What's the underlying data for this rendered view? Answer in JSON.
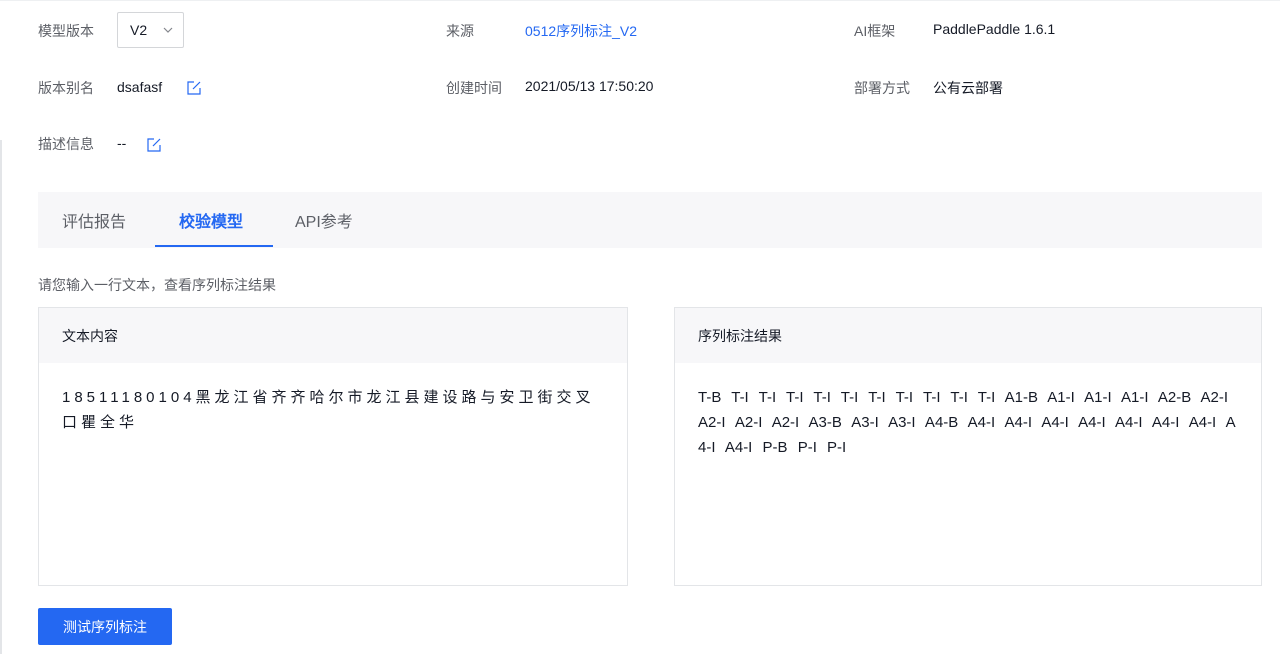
{
  "info": {
    "version": {
      "label": "模型版本",
      "value": "V2"
    },
    "source": {
      "label": "来源",
      "value": "0512序列标注_V2"
    },
    "framework": {
      "label": "AI框架",
      "value": "PaddlePaddle 1.6.1"
    },
    "alias": {
      "label": "版本别名",
      "value": "dsafasf"
    },
    "created": {
      "label": "创建时间",
      "value": "2021/05/13 17:50:20"
    },
    "deploy": {
      "label": "部署方式",
      "value": "公有云部署"
    },
    "description": {
      "label": "描述信息",
      "value": "--"
    }
  },
  "tabs": [
    {
      "label": "评估报告",
      "active": false
    },
    {
      "label": "校验模型",
      "active": true
    },
    {
      "label": "API参考",
      "active": false
    }
  ],
  "verify": {
    "hint": "请您输入一行文本，查看序列标注结果",
    "input_panel_title": "文本内容",
    "input_text": "18511180104黑龙江省齐齐哈尔市龙江县建设路与安卫街交叉口瞿全华",
    "result_panel_title": "序列标注结果",
    "result_text": "T-B T-I T-I T-I T-I T-I T-I T-I T-I T-I T-I A1-B A1-I A1-I A1-I A2-B A2-I A2-I A2-I A2-I A3-B A3-I A3-I A4-B A4-I A4-I A4-I A4-I A4-I A4-I A4-I A4-I A4-I P-B P-I P-I",
    "test_button_label": "测试序列标注"
  },
  "colors": {
    "accent": "#2468f2",
    "panel_header_bg": "#f7f7f9",
    "border": "#e3e5e8"
  }
}
